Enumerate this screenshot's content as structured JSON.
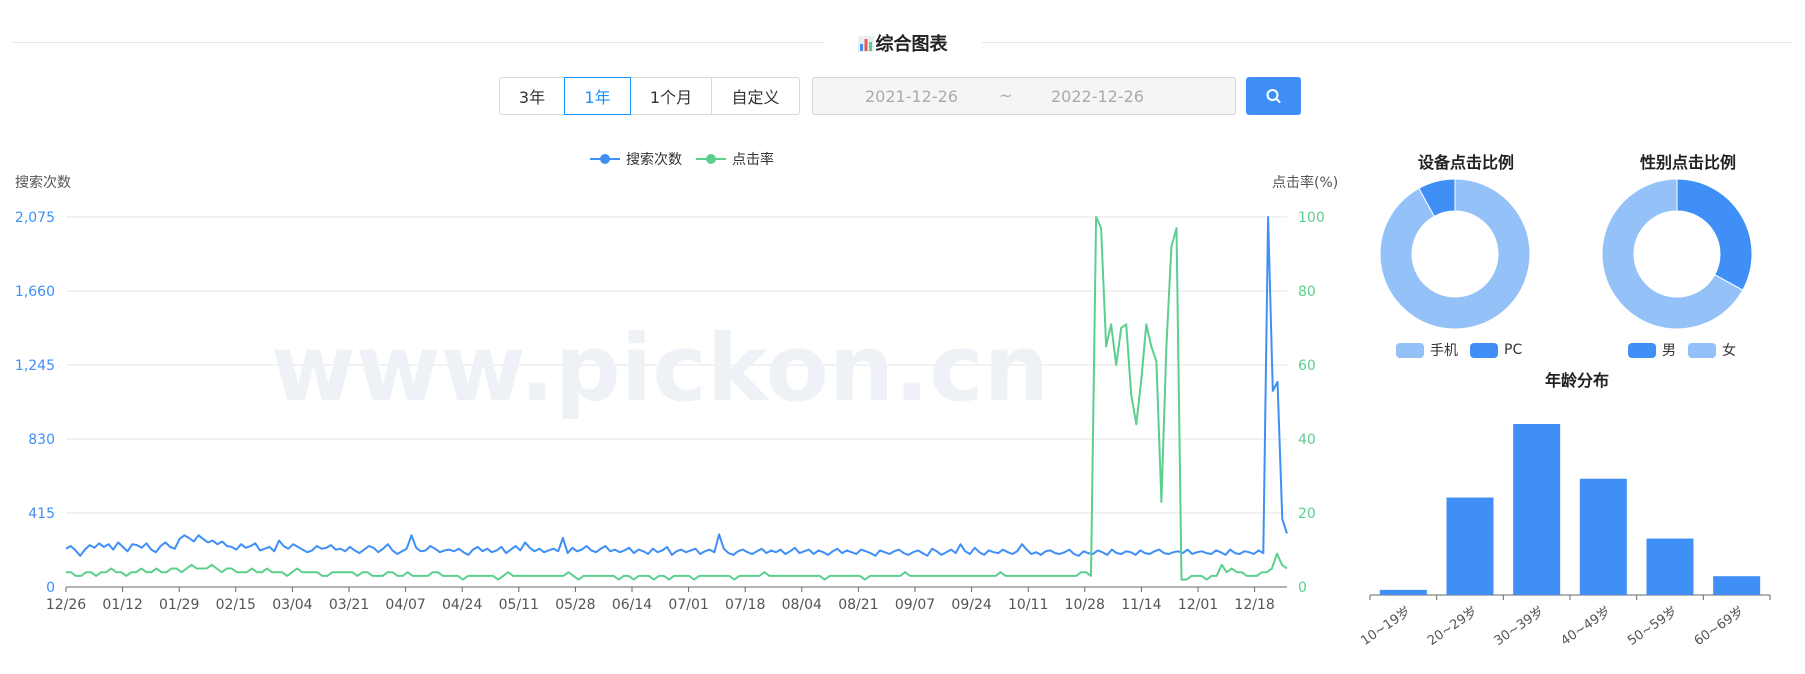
{
  "header": {
    "title": "综合图表",
    "chart_icon": "bar-chart-icon"
  },
  "range_buttons": [
    {
      "label": "3年",
      "active": false
    },
    {
      "label": "1年",
      "active": true
    },
    {
      "label": "1个月",
      "active": false
    },
    {
      "label": "自定义",
      "active": false
    }
  ],
  "date_range": {
    "start": "2021-12-26",
    "separator": "~",
    "end": "2022-12-26"
  },
  "search": {
    "icon": "search-icon"
  },
  "colors": {
    "blue": "#3f8ff6",
    "green": "#5ccf8e",
    "light_blue": "#93c1f8"
  },
  "chart_data": [
    {
      "type": "line",
      "legend": [
        "搜索次数",
        "点击率"
      ],
      "ylabel_left": "搜索次数",
      "ylabel_right": "点击率(%)",
      "yticks_left": [
        "0",
        "415",
        "830",
        "1,245",
        "1,660",
        "2,075"
      ],
      "yticks_right": [
        "0",
        "20",
        "40",
        "60",
        "80",
        "100"
      ],
      "ylim_left": [
        0,
        2075
      ],
      "ylim_right": [
        0,
        100
      ],
      "x_ticks": [
        "12/26",
        "01/12",
        "01/29",
        "02/15",
        "03/04",
        "03/21",
        "04/07",
        "04/24",
        "05/11",
        "05/28",
        "06/14",
        "07/01",
        "07/18",
        "08/04",
        "08/21",
        "09/07",
        "09/24",
        "10/11",
        "10/28",
        "11/14",
        "12/01",
        "12/18"
      ],
      "grid": true,
      "series": [
        {
          "name": "搜索次数",
          "axis": "left",
          "values": [
            215,
            230,
            205,
            175,
            210,
            235,
            220,
            245,
            225,
            240,
            210,
            250,
            225,
            200,
            240,
            235,
            220,
            245,
            210,
            195,
            230,
            250,
            225,
            215,
            270,
            290,
            275,
            255,
            290,
            270,
            250,
            260,
            240,
            255,
            230,
            225,
            210,
            240,
            220,
            230,
            245,
            205,
            215,
            225,
            200,
            260,
            230,
            215,
            240,
            225,
            210,
            195,
            205,
            230,
            215,
            220,
            235,
            210,
            215,
            200,
            225,
            205,
            190,
            210,
            230,
            220,
            195,
            215,
            240,
            205,
            185,
            200,
            215,
            290,
            220,
            200,
            205,
            230,
            215,
            195,
            205,
            210,
            200,
            215,
            195,
            180,
            210,
            225,
            200,
            215,
            195,
            205,
            225,
            190,
            210,
            230,
            205,
            250,
            220,
            200,
            215,
            195,
            205,
            215,
            200,
            275,
            190,
            220,
            200,
            210,
            230,
            205,
            195,
            215,
            230,
            200,
            210,
            195,
            205,
            220,
            190,
            210,
            200,
            185,
            215,
            195,
            205,
            225,
            180,
            200,
            210,
            195,
            205,
            215,
            185,
            200,
            210,
            195,
            295,
            215,
            190,
            180,
            200,
            210,
            195,
            185,
            200,
            215,
            190,
            205,
            195,
            210,
            185,
            200,
            220,
            190,
            200,
            210,
            185,
            205,
            195,
            180,
            200,
            215,
            190,
            205,
            195,
            185,
            210,
            200,
            190,
            175,
            205,
            195,
            185,
            200,
            210,
            190,
            180,
            195,
            205,
            190,
            175,
            215,
            200,
            180,
            195,
            210,
            190,
            240,
            200,
            185,
            220,
            195,
            180,
            205,
            195,
            190,
            210,
            195,
            185,
            200,
            240,
            210,
            185,
            195,
            180,
            200,
            205,
            190,
            185,
            195,
            210,
            185,
            175,
            200,
            190,
            185,
            205,
            195,
            180,
            210,
            190,
            185,
            200,
            195,
            180,
            205,
            190,
            185,
            200,
            210,
            190,
            185,
            195,
            200,
            190,
            210,
            185,
            195,
            200,
            190,
            185,
            205,
            195,
            180,
            210,
            190,
            185,
            200,
            195,
            185,
            205,
            190,
            2075,
            1100,
            1150,
            380,
            300
          ]
        },
        {
          "name": "点击率",
          "axis": "right",
          "values": [
            4,
            4,
            3,
            3,
            4,
            4,
            3,
            4,
            4,
            5,
            4,
            4,
            3,
            4,
            4,
            5,
            4,
            4,
            5,
            4,
            4,
            5,
            5,
            4,
            5,
            6,
            5,
            5,
            5,
            6,
            5,
            4,
            5,
            5,
            4,
            4,
            4,
            5,
            4,
            4,
            5,
            4,
            4,
            4,
            3,
            4,
            5,
            4,
            4,
            4,
            4,
            3,
            3,
            4,
            4,
            4,
            4,
            4,
            3,
            4,
            4,
            3,
            3,
            3,
            4,
            4,
            3,
            3,
            4,
            3,
            3,
            3,
            3,
            4,
            4,
            3,
            3,
            3,
            3,
            2,
            3,
            3,
            3,
            3,
            3,
            3,
            2,
            3,
            4,
            3,
            3,
            3,
            3,
            3,
            3,
            3,
            3,
            3,
            3,
            3,
            4,
            3,
            2,
            3,
            3,
            3,
            3,
            3,
            3,
            3,
            2,
            3,
            3,
            2,
            3,
            3,
            3,
            2,
            3,
            3,
            2,
            3,
            3,
            3,
            3,
            2,
            3,
            3,
            3,
            3,
            3,
            3,
            3,
            2,
            3,
            3,
            3,
            3,
            3,
            4,
            3,
            3,
            3,
            3,
            3,
            3,
            3,
            3,
            3,
            3,
            3,
            2,
            3,
            3,
            3,
            3,
            3,
            3,
            3,
            2,
            3,
            3,
            3,
            3,
            3,
            3,
            3,
            4,
            3,
            3,
            3,
            3,
            3,
            3,
            3,
            3,
            3,
            3,
            3,
            3,
            3,
            3,
            3,
            3,
            3,
            3,
            4,
            3,
            3,
            3,
            3,
            3,
            3,
            3,
            3,
            3,
            3,
            3,
            3,
            3,
            3,
            3,
            4,
            4,
            3,
            100,
            97,
            65,
            71,
            60,
            70,
            71,
            52,
            44,
            56,
            71,
            65,
            61,
            23,
            65,
            92,
            97,
            2,
            2,
            3,
            3,
            3,
            2,
            3,
            3,
            6,
            4,
            5,
            4,
            4,
            3,
            3,
            3,
            4,
            4,
            5,
            9,
            6,
            5
          ]
        }
      ]
    },
    {
      "type": "pie",
      "title": "设备点击比例",
      "slices": [
        {
          "name": "手机",
          "value": 92
        },
        {
          "name": "PC",
          "value": 8
        }
      ]
    },
    {
      "type": "pie",
      "title": "性别点击比例",
      "slices": [
        {
          "name": "男",
          "value": 33
        },
        {
          "name": "女",
          "value": 67
        }
      ]
    },
    {
      "type": "bar",
      "title": "年龄分布",
      "categories": [
        "10~19岁",
        "20~29岁",
        "30~39岁",
        "40~49岁",
        "50~59岁",
        "60~69岁"
      ],
      "values": [
        3,
        57,
        100,
        68,
        33,
        11
      ]
    }
  ]
}
